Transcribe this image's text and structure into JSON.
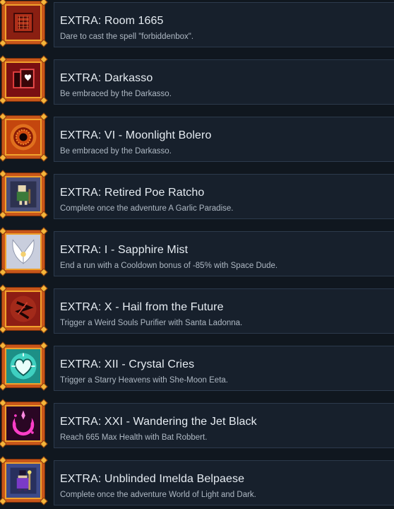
{
  "achievements": [
    {
      "title": "EXTRA: Room 1665",
      "description": "Dare to cast the spell \"forbiddenbox\".",
      "icon": "rune-box-icon",
      "icon_bg": "#8a1f12"
    },
    {
      "title": "EXTRA: Darkasso",
      "description": "Be embraced by the Darkasso.",
      "icon": "card-heart-icon",
      "icon_bg": "#7a0f12"
    },
    {
      "title": "EXTRA: VI - Moonlight Bolero",
      "description": "Be embraced by the Darkasso.",
      "icon": "eye-icon",
      "icon_bg": "#c4460e"
    },
    {
      "title": "EXTRA: Retired Poe Ratcho",
      "description": "Complete once the adventure A Garlic Paradise.",
      "icon": "old-man-sprite-icon",
      "icon_bg": "#4a4f7a"
    },
    {
      "title": "EXTRA: I - Sapphire Mist",
      "description": "End a run with a Cooldown bonus of -85% with Space Dude.",
      "icon": "wings-icon",
      "icon_bg": "#d8dce8"
    },
    {
      "title": "EXTRA: X - Hail from the Future",
      "description": "Trigger a Weird Souls Purifier with Santa Ladonna.",
      "icon": "red-sigil-icon",
      "icon_bg": "#8e1d14"
    },
    {
      "title": "EXTRA: XII - Crystal Cries",
      "description": "Trigger a Starry Heavens with She-Moon Eeta.",
      "icon": "crystal-heart-icon",
      "icon_bg": "#2bb6a6"
    },
    {
      "title": "EXTRA: XXI - Wandering the Jet Black",
      "description": "Reach 665 Max Health with Bat Robbert.",
      "icon": "crescent-moon-icon",
      "icon_bg": "#3a0830"
    },
    {
      "title": "EXTRA: Unblinded Imelda Belpaese",
      "description": "Complete once the adventure World of Light and Dark.",
      "icon": "mage-sprite-icon",
      "icon_bg": "#3d4a8a"
    }
  ]
}
